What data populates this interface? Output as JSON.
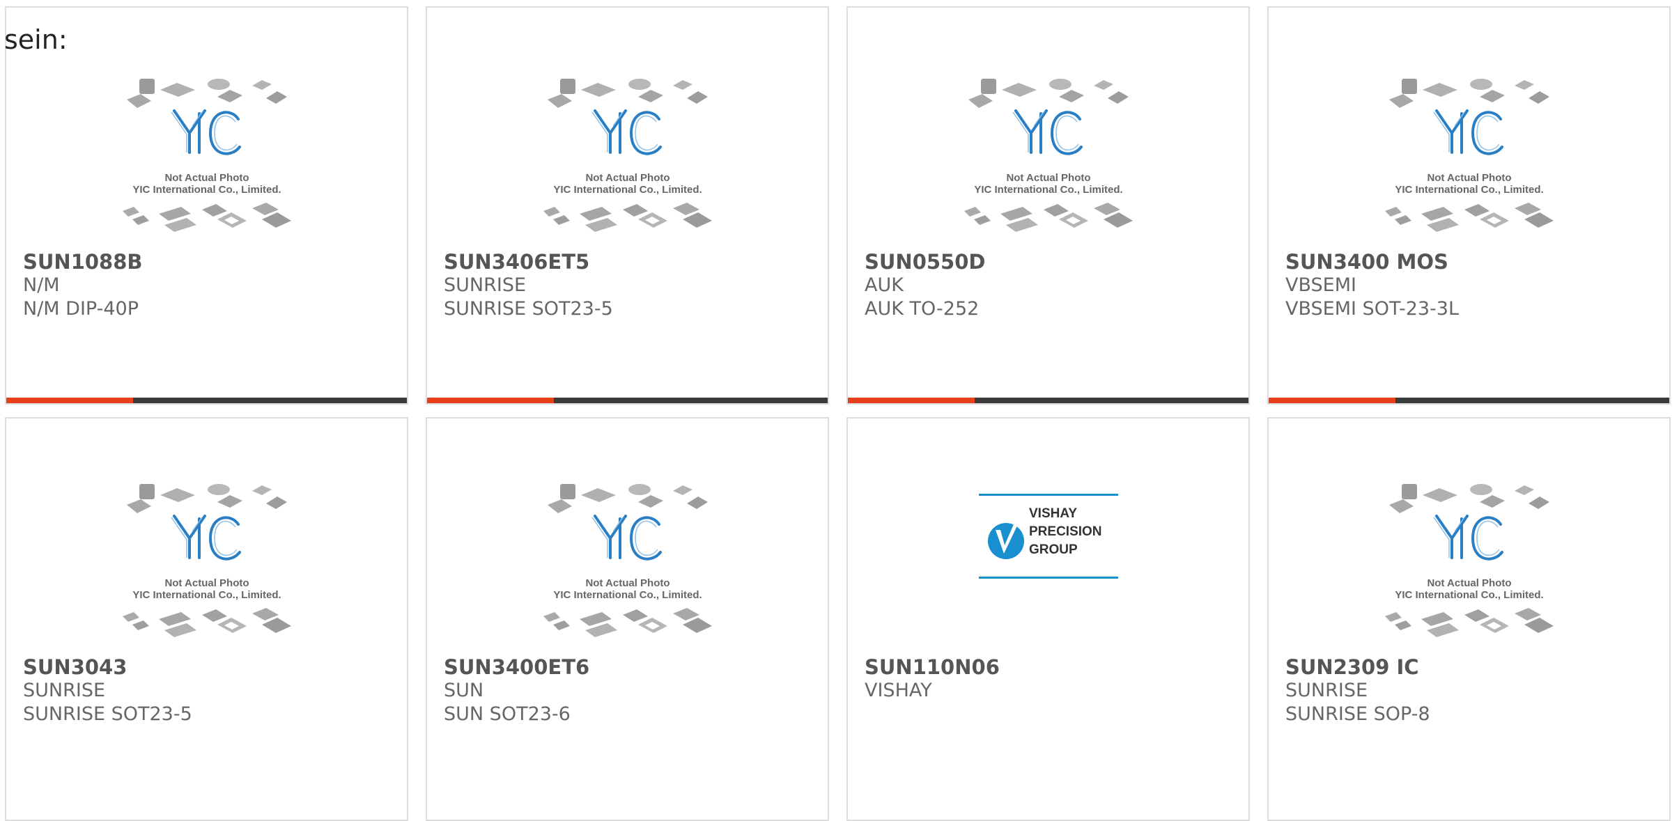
{
  "intro_text": "sein:",
  "placeholder_caption": [
    "Not Actual Photo",
    "YIC International Co., Limited."
  ],
  "vishay_logo": [
    "VISHAY",
    "PRECISION",
    "GROUP"
  ],
  "colors": {
    "accent": "#e8401c",
    "bar_dark": "#3a3a3a",
    "logo_blue": "#1a8fd0"
  },
  "products": [
    {
      "part": "SUN1088B",
      "brand": "N/M",
      "package": "N/M DIP-40P",
      "image": "yic-placeholder"
    },
    {
      "part": "SUN3406ET5",
      "brand": "SUNRISE",
      "package": "SUNRISE SOT23-5",
      "image": "yic-placeholder"
    },
    {
      "part": "SUN0550D",
      "brand": "AUK",
      "package": "AUK TO-252",
      "image": "yic-placeholder"
    },
    {
      "part": "SUN3400 MOS",
      "brand": "VBSEMI",
      "package": "VBSEMI SOT-23-3L",
      "image": "yic-placeholder"
    },
    {
      "part": "SUN3043",
      "brand": "SUNRISE",
      "package": "SUNRISE SOT23-5",
      "image": "yic-placeholder"
    },
    {
      "part": "SUN3400ET6",
      "brand": "SUN",
      "package": "SUN SOT23-6",
      "image": "yic-placeholder"
    },
    {
      "part": "SUN110N06",
      "brand": "VISHAY",
      "package": "",
      "image": "vishay-logo"
    },
    {
      "part": "SUN2309 IC",
      "brand": "SUNRISE",
      "package": "SUNRISE SOP-8",
      "image": "yic-placeholder"
    }
  ]
}
